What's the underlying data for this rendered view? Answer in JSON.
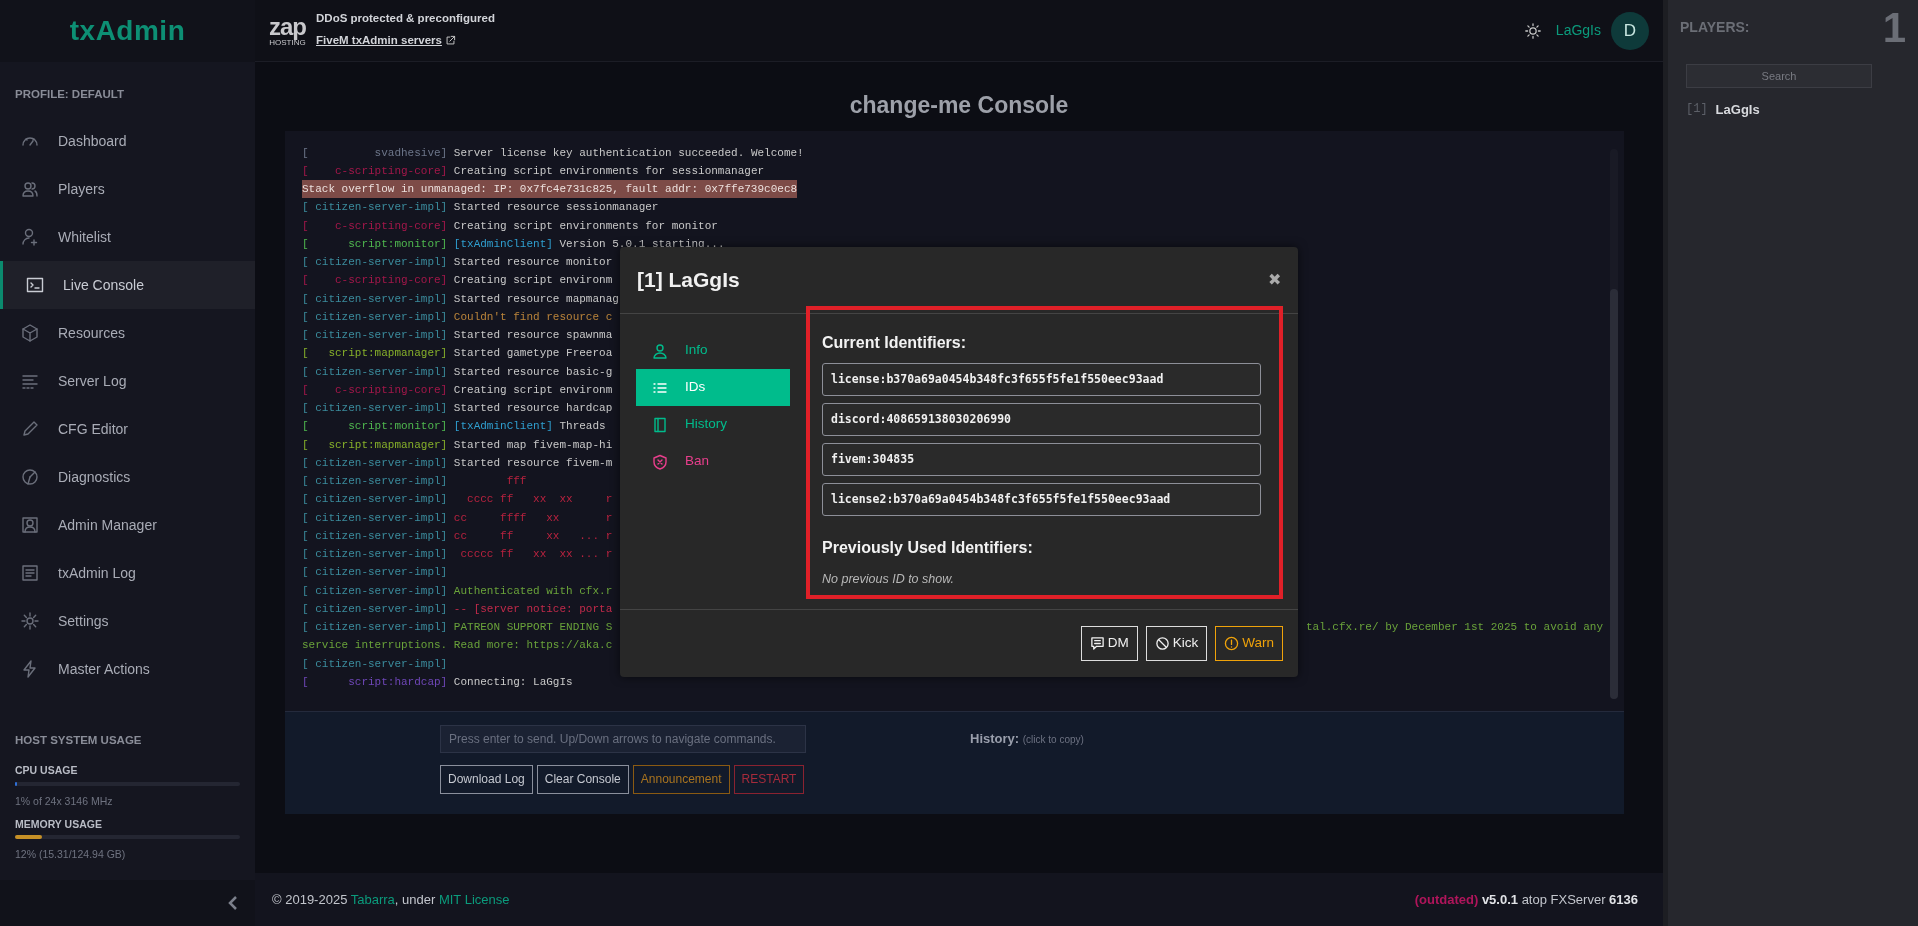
{
  "sidebar": {
    "logo": "txAdmin",
    "profile": "PROFILE: DEFAULT",
    "items": [
      {
        "label": "Dashboard",
        "kind": "gauge",
        "selected": false
      },
      {
        "label": "Players",
        "kind": "users",
        "selected": false
      },
      {
        "label": "Whitelist",
        "kind": "user-plus",
        "selected": false
      },
      {
        "label": "Live Console",
        "kind": "terminal",
        "selected": true
      },
      {
        "label": "Resources",
        "kind": "cube",
        "selected": false
      },
      {
        "label": "Server Log",
        "kind": "lines",
        "selected": false
      },
      {
        "label": "CFG Editor",
        "kind": "pencil",
        "selected": false
      },
      {
        "label": "Diagnostics",
        "kind": "pie",
        "selected": false
      },
      {
        "label": "Admin Manager",
        "kind": "portrait",
        "selected": false
      },
      {
        "label": "txAdmin Log",
        "kind": "doc",
        "selected": false
      },
      {
        "label": "Settings",
        "kind": "gear",
        "selected": false
      },
      {
        "label": "Master Actions",
        "kind": "bolt",
        "selected": false
      }
    ],
    "host_usage": {
      "title": "HOST SYSTEM USAGE",
      "meters": [
        {
          "label": "CPU USAGE",
          "level": 0.01,
          "reading": "1% of 24x 3146 MHz",
          "color": "#2f6fd6"
        },
        {
          "label": "MEMORY USAGE",
          "level": 0.12,
          "reading": "12% (15.31/124.94 GB)",
          "color": "#c69026"
        }
      ]
    }
  },
  "topbar": {
    "ad": {
      "logo_text": "zap",
      "logo_sub": "HOSTING",
      "line1": "DDoS protected & preconfigured",
      "line2": "FiveM txAdmin servers"
    },
    "user": {
      "name": "LaGgIs",
      "avatar": "D"
    }
  },
  "page_title": "change-me Console",
  "console": {
    "lines": [
      {
        "prefix": "[          svadhesive]",
        "color": "#6c7589",
        "segments": [
          {
            "text": "Server license key authentication succeeded. Welcome!",
            "kind": "normal"
          }
        ]
      },
      {
        "prefix": "[    c-scripting-core]",
        "color": "#a3174a",
        "segments": [
          {
            "text": "Creating script environments for sessionmanager",
            "kind": "normal"
          }
        ]
      },
      {
        "segments": [
          {
            "text": "Stack overflow in unmanaged: IP: 0x7fc4e731c825, fault addr: 0x7ffe739c0ec8",
            "kind": "error"
          }
        ]
      },
      {
        "prefix": "[ citizen-server-impl]",
        "color": "#3b8c9d",
        "segments": [
          {
            "text": "Started resource sessionmanager",
            "kind": "normal"
          }
        ]
      },
      {
        "prefix": "[    c-scripting-core]",
        "color": "#a3174a",
        "segments": [
          {
            "text": "Creating script environments for monitor",
            "kind": "normal"
          }
        ]
      },
      {
        "prefix": "[      script:monitor]",
        "color": "#4fb84f",
        "segments": [
          {
            "text": "[txAdminClient]",
            "kind": "client"
          },
          {
            "text": " Version 5.0.1 starting...",
            "kind": "normal"
          }
        ]
      },
      {
        "prefix": "[ citizen-server-impl]",
        "color": "#3b8c9d",
        "segments": [
          {
            "text": "Started resource monitor",
            "kind": "normal"
          }
        ]
      },
      {
        "prefix": "[    c-scripting-core]",
        "color": "#a3174a",
        "segments": [
          {
            "text": "Creating script environm",
            "kind": "normal"
          }
        ]
      },
      {
        "prefix": "[ citizen-server-impl]",
        "color": "#3b8c9d",
        "segments": [
          {
            "text": "Started resource mapmanag",
            "kind": "normal"
          }
        ]
      },
      {
        "prefix": "[ citizen-server-impl]",
        "color": "#3b8c9d",
        "segments": [
          {
            "text": "Couldn't find resource c",
            "kind": "warn"
          }
        ]
      },
      {
        "prefix": "[ citizen-server-impl]",
        "color": "#3b8c9d",
        "segments": [
          {
            "text": "Started resource spawnma",
            "kind": "normal"
          }
        ]
      },
      {
        "prefix": "[   script:mapmanager]",
        "color": "#86b02a",
        "segments": [
          {
            "text": "Started gametype Freeroa",
            "kind": "normal"
          }
        ]
      },
      {
        "prefix": "[ citizen-server-impl]",
        "color": "#3b8c9d",
        "segments": [
          {
            "text": "Started resource basic-g",
            "kind": "normal"
          }
        ]
      },
      {
        "prefix": "[    c-scripting-core]",
        "color": "#a3174a",
        "segments": [
          {
            "text": "Creating script environm",
            "kind": "normal"
          }
        ]
      },
      {
        "prefix": "[ citizen-server-impl]",
        "color": "#3b8c9d",
        "segments": [
          {
            "text": "Started resource hardcap",
            "kind": "normal"
          }
        ]
      },
      {
        "prefix": "[      script:monitor]",
        "color": "#4fb84f",
        "segments": [
          {
            "text": "[txAdminClient]",
            "kind": "client"
          },
          {
            "text": " Threads",
            "kind": "normal"
          }
        ]
      },
      {
        "prefix": "[   script:mapmanager]",
        "color": "#86b02a",
        "segments": [
          {
            "text": "Started map fivem-map-hi",
            "kind": "normal"
          }
        ]
      },
      {
        "prefix": "[ citizen-server-impl]",
        "color": "#3b8c9d",
        "segments": [
          {
            "text": "Started resource fivem-m",
            "kind": "normal"
          }
        ]
      },
      {
        "prefix": "[ citizen-server-impl]",
        "color": "#3b8c9d",
        "segments": [
          {
            "text": "        fff",
            "kind": "art"
          }
        ]
      },
      {
        "prefix": "[ citizen-server-impl]",
        "color": "#3b8c9d",
        "segments": [
          {
            "text": "  cccc ff   xx  xx     r",
            "kind": "art"
          }
        ]
      },
      {
        "prefix": "[ citizen-server-impl]",
        "color": "#3b8c9d",
        "segments": [
          {
            "text": "cc     ffff   xx       r",
            "kind": "art"
          }
        ]
      },
      {
        "prefix": "[ citizen-server-impl]",
        "color": "#3b8c9d",
        "segments": [
          {
            "text": "cc     ff     xx   ... r",
            "kind": "art"
          }
        ]
      },
      {
        "prefix": "[ citizen-server-impl]",
        "color": "#3b8c9d",
        "segments": [
          {
            "text": " ccccc ff   xx  xx ... r",
            "kind": "art"
          }
        ]
      },
      {
        "prefix": "[ citizen-server-impl]",
        "color": "#3b8c9d"
      },
      {
        "prefix": "[ citizen-server-impl]",
        "color": "#3b8c9d",
        "segments": [
          {
            "text": "Authenticated with cfx.r",
            "kind": "green"
          }
        ]
      },
      {
        "prefix": "[ citizen-server-impl]",
        "color": "#3b8c9d",
        "segments": [
          {
            "text": "-- [server notice: porta",
            "kind": "notice"
          }
        ]
      },
      {
        "prefix": "[ citizen-server-impl]",
        "color": "#3b8c9d",
        "segments": [
          {
            "text": "PATREON SUPPORT ENDING S",
            "kind": "green"
          }
        ],
        "tail": "tal.cfx.re/ by December 1st 2025 to avoid any"
      },
      {
        "segments": [
          {
            "text": "service interruptions. Read more: https://aka.c",
            "kind": "green"
          }
        ]
      },
      {
        "prefix": "[ citizen-server-impl]",
        "color": "#3b8c9d"
      },
      {
        "prefix": "[      script:hardcap]",
        "color": "#6f47b8",
        "segments": [
          {
            "text": "Connecting: LaGgIs",
            "kind": "normal"
          }
        ]
      }
    ]
  },
  "command": {
    "placeholder": "Press enter to send. Up/Down arrows to navigate commands.",
    "history_label": "History:",
    "history_hint": "(click to copy)",
    "buttons": [
      {
        "label": "Download Log",
        "kind": "default"
      },
      {
        "label": "Clear Console",
        "kind": "default"
      },
      {
        "label": "Announcement",
        "kind": "warning"
      },
      {
        "label": "RESTART",
        "kind": "danger"
      }
    ]
  },
  "footer": {
    "left": [
      {
        "text": "© 2019-2025 "
      },
      {
        "text": "Tabarra",
        "link": true
      },
      {
        "text": ", under "
      },
      {
        "text": "MIT License",
        "link": true
      }
    ],
    "right": [
      {
        "text": "(outdated)",
        "kind": "outdated"
      },
      {
        "text": " v5.0.1",
        "kind": "bold"
      },
      {
        "text": " atop FXServer "
      },
      {
        "text": "6136",
        "kind": "bold"
      }
    ]
  },
  "players_panel": {
    "title": "PLAYERS:",
    "count": "1",
    "search_placeholder": "Search",
    "players": [
      {
        "id": "[1]",
        "name": "LaGgIs"
      }
    ]
  },
  "modal": {
    "title": "[1] LaGgIs",
    "close": "✖",
    "tabs": [
      {
        "label": "Info",
        "kind": "info",
        "selected": false
      },
      {
        "label": "IDs",
        "kind": "ids",
        "selected": true
      },
      {
        "label": "History",
        "kind": "history",
        "selected": false
      },
      {
        "label": "Ban",
        "kind": "ban",
        "selected": false
      }
    ],
    "panel": {
      "highlighted": true,
      "current_title": "Current Identifiers:",
      "identifiers": [
        "license:b370a69a0454b348fc3f655f5fe1f550eec93aad",
        "discord:408659138030206990",
        "fivem:304835",
        "license2:b370a69a0454b348fc3f655f5fe1f550eec93aad"
      ],
      "previous_title": "Previously Used Identifiers:",
      "previous_empty": "No previous ID to show."
    },
    "buttons": [
      {
        "label": "DM",
        "kind": "dm"
      },
      {
        "label": "Kick",
        "kind": "kick"
      },
      {
        "label": "Warn",
        "kind": "warn"
      }
    ]
  }
}
